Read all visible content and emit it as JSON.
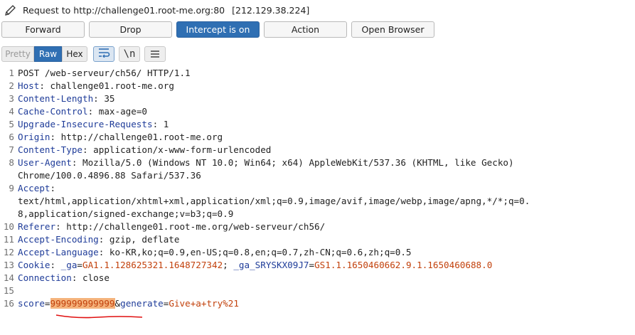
{
  "header": {
    "title": "Request to http://challenge01.root-me.org:80",
    "ip": "[212.129.38.224]"
  },
  "buttons": {
    "forward": "Forward",
    "drop": "Drop",
    "intercept": "Intercept is on",
    "action": "Action",
    "open_browser": "Open Browser"
  },
  "view": {
    "pretty": "Pretty",
    "raw": "Raw",
    "hex": "Hex",
    "newline_toggle": "\\n"
  },
  "request": {
    "line1": "POST /web-serveur/ch56/ HTTP/1.1",
    "headers": [
      {
        "name": "Host",
        "value": "challenge01.root-me.org"
      },
      {
        "name": "Content-Length",
        "value": "35"
      },
      {
        "name": "Cache-Control",
        "value": "max-age=0"
      },
      {
        "name": "Upgrade-Insecure-Requests",
        "value": "1"
      },
      {
        "name": "Origin",
        "value": "http://challenge01.root-me.org"
      },
      {
        "name": "Content-Type",
        "value": "application/x-www-form-urlencoded"
      },
      {
        "name": "User-Agent",
        "value": "Mozilla/5.0 (Windows NT 10.0; Win64; x64) AppleWebKit/537.36 (KHTML, like Gecko)",
        "value_cont": "Chrome/100.0.4896.88 Safari/537.36"
      },
      {
        "name": "Accept",
        "value": "",
        "value_cont": "text/html,application/xhtml+xml,application/xml;q=0.9,image/avif,image/webp,image/apng,*/*;q=0.",
        "value_cont2": "8,application/signed-exchange;v=b3;q=0.9"
      },
      {
        "name": "Referer",
        "value": "http://challenge01.root-me.org/web-serveur/ch56/"
      },
      {
        "name": "Accept-Encoding",
        "value": "gzip, deflate"
      },
      {
        "name": "Accept-Language",
        "value": "ko-KR,ko;q=0.9,en-US;q=0.8,en;q=0.7,zh-CN;q=0.6,zh;q=0.5"
      },
      {
        "name": "Cookie",
        "value": ""
      },
      {
        "name": "Connection",
        "value": "close"
      }
    ],
    "cookies": [
      {
        "name": "_ga",
        "value": "GA1.1.128625321.1648727342"
      },
      {
        "name": "_ga_SRYSKX09J7",
        "value": "GS1.1.1650460662.9.1.1650460688.0"
      }
    ],
    "body": [
      {
        "name": "score",
        "value": "999999999999"
      },
      {
        "name": "generate",
        "value": "Give+a+try%21"
      }
    ],
    "line_numbers": [
      "1",
      "2",
      "3",
      "4",
      "5",
      "6",
      "7",
      "8",
      "9",
      "10",
      "11",
      "12",
      "13",
      "14",
      "15",
      "16"
    ]
  },
  "colors": {
    "accent": "#2f6fb3",
    "header_name": "#1f3c99",
    "value_highlight": "#c2410c",
    "selection": "#f5b37c",
    "annotation": "#e01010"
  }
}
